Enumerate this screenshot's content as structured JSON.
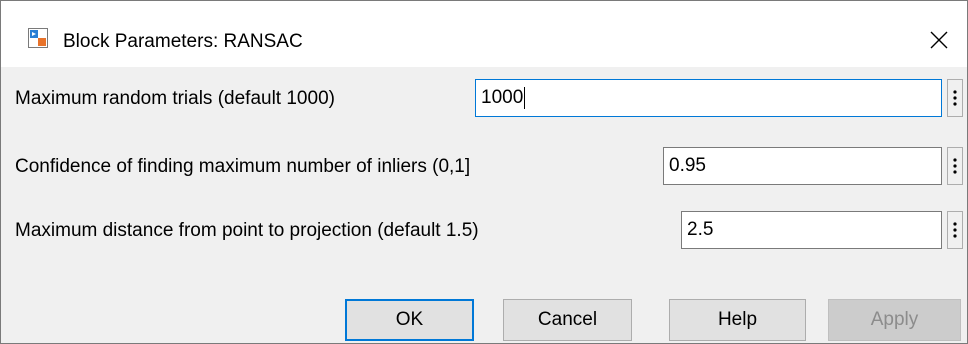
{
  "window": {
    "title": "Block Parameters: RANSAC"
  },
  "params": [
    {
      "label": "Maximum random trials (default 1000)",
      "value": "1000"
    },
    {
      "label": "Confidence of finding maximum number of inliers (0,1]",
      "value": "0.95"
    },
    {
      "label": "Maximum distance from point to projection (default 1.5)",
      "value": "2.5"
    }
  ],
  "buttons": {
    "ok": "OK",
    "cancel": "Cancel",
    "help": "Help",
    "apply": "Apply"
  },
  "icons": {
    "app": "simulink-block-icon",
    "close": "close-icon",
    "more": "vertical-ellipsis-icon"
  }
}
